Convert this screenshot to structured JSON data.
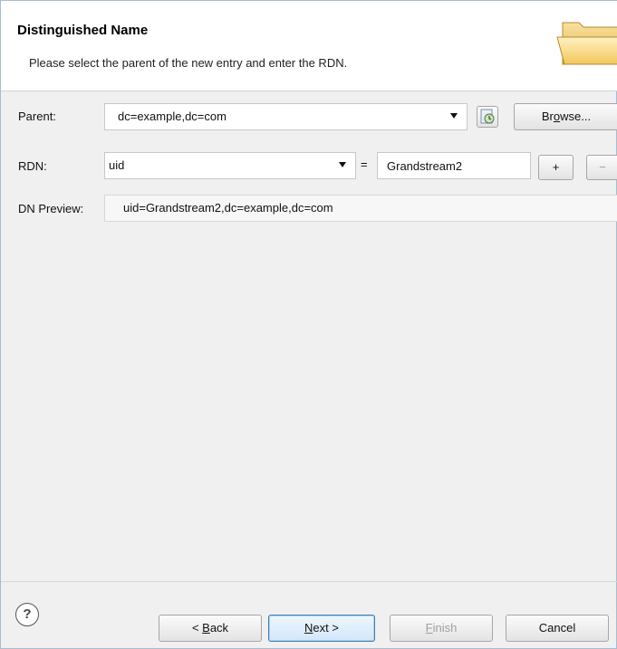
{
  "header": {
    "title": "Distinguished Name",
    "subtitle": "Please select the parent of the new entry and enter the RDN."
  },
  "form": {
    "parent_label": "Parent:",
    "parent_value": "dc=example,dc=com",
    "browse_pre": "Br",
    "browse_u": "o",
    "browse_post": "wse...",
    "rdn_label": "RDN:",
    "rdn_attr": "uid",
    "eq_sign": "=",
    "rdn_value": "Grandstream2",
    "add_label": "+",
    "remove_label": "−",
    "preview_label": "DN Preview:",
    "preview_value": "uid=Grandstream2,dc=example,dc=com"
  },
  "footer": {
    "help_glyph": "?",
    "back_pre": "< ",
    "back_u": "B",
    "back_post": "ack",
    "next_u": "N",
    "next_post": "ext >",
    "finish_u": "F",
    "finish_post": "inish",
    "cancel": "Cancel"
  },
  "icons": {
    "folder": "folder-open-icon",
    "history": "history-icon",
    "help": "help-icon"
  }
}
